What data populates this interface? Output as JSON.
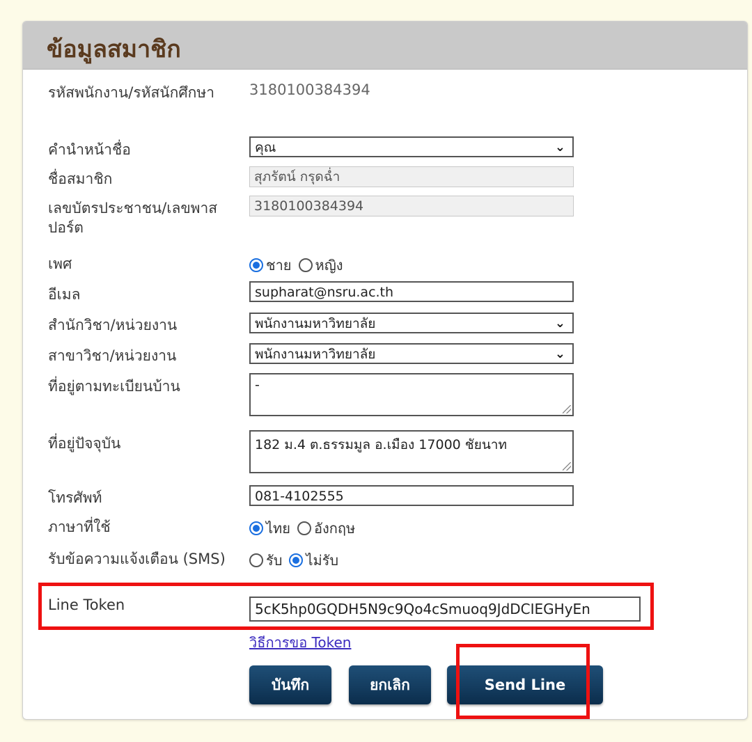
{
  "panel": {
    "title": "ข้อมูลสมาชิก"
  },
  "form": {
    "employee_id": {
      "label": "รหัสพนักงาน/รหัสนักศึกษา",
      "value": "3180100384394"
    },
    "title_prefix": {
      "label": "คำนำหน้าชื่อ",
      "value": "คุณ"
    },
    "member_name": {
      "label": "ชื่อสมาชิก",
      "value": "สุภรัตน์ กรุดฉ่ำ"
    },
    "id_card": {
      "label": "เลขบัตรประชาชน/เลขพาสปอร์ต",
      "value": "3180100384394"
    },
    "gender": {
      "label": "เพศ",
      "options": [
        "ชาย",
        "หญิง"
      ],
      "selected": "ชาย"
    },
    "email": {
      "label": "อีเมล",
      "value": "supharat@nsru.ac.th"
    },
    "faculty": {
      "label": "สำนักวิชา/หน่วยงาน",
      "value": "พนักงานมหาวิทยาลัย"
    },
    "branch": {
      "label": "สาขาวิชา/หน่วยงาน",
      "value": "พนักงานมหาวิทยาลัย"
    },
    "registered_address": {
      "label": "ที่อยู่ตามทะเบียนบ้าน",
      "value": "-"
    },
    "current_address": {
      "label": "ที่อยู่ปัจจุบัน",
      "value": "182 ม.4 ต.ธรรมมูล อ.เมือง  17000 ชัยนาท"
    },
    "phone": {
      "label": "โทรศัพท์",
      "value": "081-4102555"
    },
    "language": {
      "label": "ภาษาที่ใช้",
      "options": [
        "ไทย",
        "อังกฤษ"
      ],
      "selected": "ไทย"
    },
    "sms": {
      "label": "รับข้อความแจ้งเตือน (SMS)",
      "options": [
        "รับ",
        "ไม่รับ"
      ],
      "selected": "ไม่รับ"
    },
    "line_token": {
      "label": "Line Token",
      "value": "5cK5hp0GQDH5N9c9Qo4cSmuoq9JdDCIEGHyEn"
    },
    "token_help_link": "วิธีการขอ Token"
  },
  "buttons": {
    "save": "บันทึก",
    "cancel": "ยกเลิก",
    "send_line": "Send Line"
  },
  "colors": {
    "highlight": "#ee1111",
    "button": "#0b2d4c",
    "header": "#c9c9c9"
  }
}
